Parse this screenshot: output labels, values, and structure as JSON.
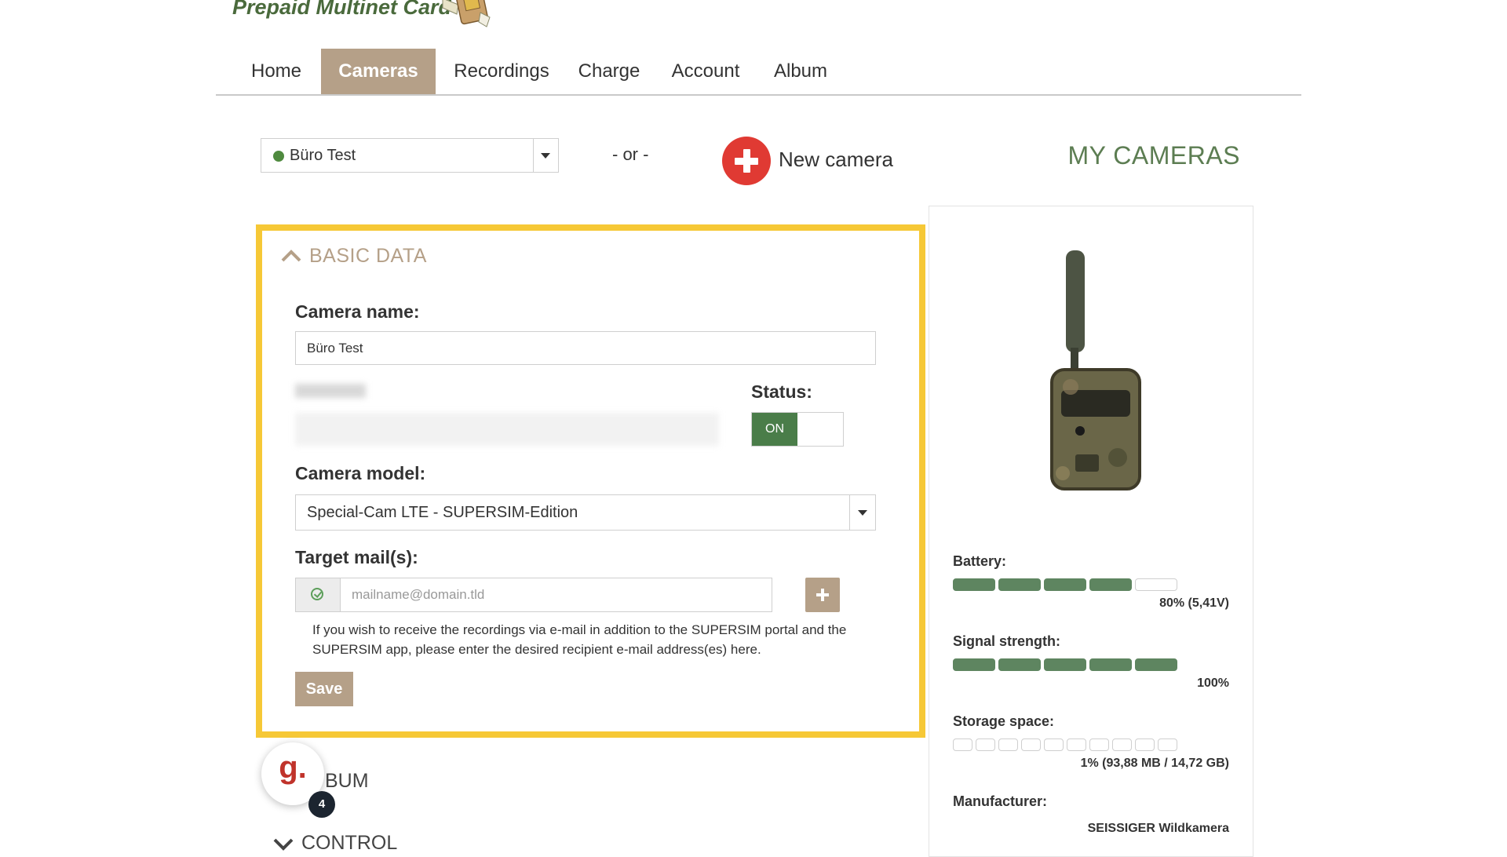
{
  "header": {
    "logo_text": "Prepaid Multinet Card"
  },
  "nav": {
    "tabs": [
      {
        "label": "Home",
        "active": false
      },
      {
        "label": "Cameras",
        "active": true
      },
      {
        "label": "Recordings",
        "active": false
      },
      {
        "label": "Charge",
        "active": false
      },
      {
        "label": "Account",
        "active": false
      },
      {
        "label": "Album",
        "active": false
      }
    ]
  },
  "toolbar": {
    "selected_camera": "Büro Test",
    "selected_camera_status_color": "#4f8a3f",
    "or_text": "- or -",
    "new_camera_label": "New camera",
    "page_heading": "MY CAMERAS"
  },
  "basic_data": {
    "title": "BASIC DATA",
    "camera_name_label": "Camera name:",
    "camera_name_value": "Büro Test",
    "status_label": "Status:",
    "status_value": "ON",
    "camera_model_label": "Camera model:",
    "camera_model_value": "Special-Cam LTE - SUPERSIM-Edition",
    "target_mail_label": "Target mail(s):",
    "target_mail_placeholder": "mailname@domain.tld",
    "target_mail_help": "If you wish to receive the recordings via e-mail in addition to the SUPERSIM portal and the SUPERSIM app, please enter the desired recipient e-mail address(es) here.",
    "save_label": "Save"
  },
  "sections": {
    "album_title": "BUM",
    "control_title": "CONTROL"
  },
  "chat_widget": {
    "letter": "g.",
    "badge": "4"
  },
  "camera_info": {
    "battery_label": "Battery:",
    "battery_filled": 4,
    "battery_total": 5,
    "battery_value": "80% (5,41V)",
    "signal_label": "Signal strength:",
    "signal_filled": 5,
    "signal_total": 5,
    "signal_value": "100%",
    "storage_label": "Storage space:",
    "storage_filled": 0,
    "storage_total": 10,
    "storage_value": "1% (93,88 MB / 14,72 GB)",
    "manufacturer_label": "Manufacturer:",
    "manufacturer_value": "SEISSIGER Wildkamera"
  },
  "colors": {
    "accent": "#b5a088",
    "highlight_border": "#f6c836",
    "bar_green": "#5e8560",
    "heading_green": "#5c7d52",
    "new_button_red": "#e03a33"
  }
}
